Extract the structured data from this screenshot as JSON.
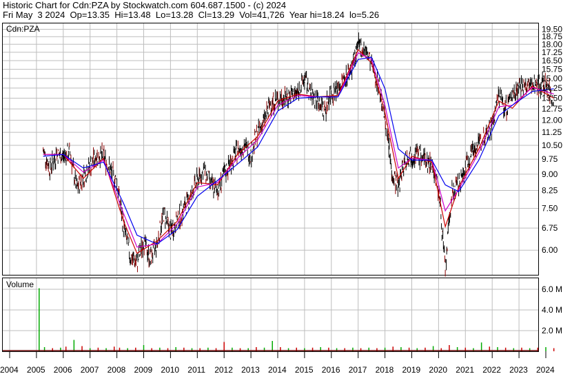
{
  "header": {
    "line1": "Historic Chart for Cdn:PZA by Stockwatch.com 604.687.1500 - (c) 2024",
    "line2": "Fri May  3 2024  Op=13.35  Hi=13.48  Lo=13.28  Cl=13.29  Vol=41,726  Year hi=18.24  lo=5.26"
  },
  "colors": {
    "price_bars": "#000000",
    "ma_short": "#cc0000",
    "ma_mid": "#cc00cc",
    "ma_long": "#0000ee",
    "vol_up": "#00aa00",
    "vol_down": "#cc0000",
    "grid": "#bdbdbd"
  },
  "chart_data": [
    {
      "type": "line",
      "label": "Cdn:PZA",
      "price_scale": "log",
      "ylim": [
        5.26,
        19.9
      ],
      "x_ticks": [
        "2004",
        "2005",
        "2006",
        "2007",
        "2008",
        "2009",
        "2010",
        "2011",
        "2012",
        "2013",
        "2014",
        "2015",
        "2016",
        "2017",
        "2018",
        "2019",
        "2020",
        "2021",
        "2022",
        "2023",
        "2024"
      ],
      "y_ticks": [
        "19.50",
        "18.75",
        "18.00",
        "17.25",
        "16.50",
        "15.75",
        "15.00",
        "14.25",
        "13.50",
        "12.75",
        "12.00",
        "11.25",
        "10.50",
        "9.75",
        "9.00",
        "8.25",
        "7.50",
        "6.75",
        "6.00"
      ],
      "grid": true,
      "series": [
        {
          "key": "price",
          "x": [
            2005.25,
            2005.5,
            2005.75,
            2006.0,
            2006.25,
            2006.5,
            2006.75,
            2007.0,
            2007.25,
            2007.5,
            2007.75,
            2008.0,
            2008.25,
            2008.5,
            2008.75,
            2009.0,
            2009.25,
            2009.5,
            2009.75,
            2010.0,
            2010.25,
            2010.5,
            2010.75,
            2011.0,
            2011.25,
            2011.5,
            2011.75,
            2012.0,
            2012.25,
            2012.5,
            2012.75,
            2013.0,
            2013.25,
            2013.5,
            2013.75,
            2014.0,
            2014.25,
            2014.5,
            2014.75,
            2015.0,
            2015.25,
            2015.5,
            2015.75,
            2016.0,
            2016.25,
            2016.5,
            2016.75,
            2017.0,
            2017.25,
            2017.5,
            2017.75,
            2018.0,
            2018.25,
            2018.5,
            2018.75,
            2019.0,
            2019.25,
            2019.5,
            2019.75,
            2020.0,
            2020.25,
            2020.5,
            2020.75,
            2021.0,
            2021.25,
            2021.5,
            2021.75,
            2022.0,
            2022.25,
            2022.5,
            2022.75,
            2023.0,
            2023.25,
            2023.5,
            2023.75,
            2024.0,
            2024.3
          ],
          "y": [
            10.2,
            9.3,
            10.0,
            9.9,
            10.1,
            8.3,
            8.9,
            9.4,
            10.0,
            9.9,
            9.2,
            8.6,
            6.8,
            5.8,
            5.6,
            6.3,
            5.7,
            6.2,
            7.3,
            6.6,
            7.0,
            7.5,
            8.0,
            8.7,
            9.2,
            8.5,
            8.3,
            9.0,
            9.6,
            10.2,
            10.5,
            10.0,
            11.2,
            12.0,
            13.2,
            13.4,
            13.6,
            13.7,
            13.9,
            15.0,
            13.7,
            13.4,
            12.6,
            14.0,
            14.1,
            15.0,
            15.9,
            17.8,
            17.5,
            16.2,
            14.6,
            12.2,
            9.1,
            8.4,
            9.8,
            10.0,
            10.0,
            9.7,
            9.5,
            8.3,
            5.3,
            8.2,
            8.5,
            9.3,
            10.3,
            10.5,
            11.2,
            11.6,
            13.8,
            12.7,
            13.8,
            14.5,
            14.2,
            14.6,
            14.5,
            14.5,
            13.29
          ]
        },
        {
          "key": "ma_short",
          "x": [
            2005.25,
            2006.0,
            2006.75,
            2007.5,
            2008.25,
            2008.75,
            2009.5,
            2010.25,
            2011.0,
            2011.75,
            2012.5,
            2013.25,
            2014.0,
            2014.75,
            2015.5,
            2016.25,
            2017.0,
            2017.5,
            2018.0,
            2018.5,
            2019.0,
            2019.75,
            2020.25,
            2020.75,
            2021.5,
            2022.25,
            2022.75,
            2023.5,
            2024.3
          ],
          "y": [
            10.0,
            10.0,
            8.8,
            9.8,
            7.0,
            5.9,
            6.3,
            7.0,
            8.6,
            8.5,
            10.0,
            11.0,
            13.3,
            13.8,
            13.6,
            13.7,
            17.5,
            16.3,
            12.5,
            8.8,
            9.9,
            9.6,
            6.8,
            8.4,
            10.3,
            13.3,
            12.8,
            14.4,
            13.5
          ]
        },
        {
          "key": "ma_mid",
          "x": [
            2005.25,
            2006.0,
            2006.75,
            2007.5,
            2008.25,
            2008.75,
            2009.5,
            2010.25,
            2011.0,
            2011.75,
            2012.5,
            2013.25,
            2014.0,
            2014.75,
            2015.5,
            2016.25,
            2017.0,
            2017.5,
            2018.0,
            2018.5,
            2019.0,
            2019.75,
            2020.25,
            2020.75,
            2021.5,
            2022.25,
            2022.75,
            2023.5,
            2024.3
          ],
          "y": [
            10.0,
            10.0,
            9.1,
            9.7,
            7.3,
            6.1,
            6.2,
            6.9,
            8.4,
            8.6,
            9.8,
            10.8,
            13.0,
            13.7,
            13.6,
            13.6,
            17.2,
            16.6,
            13.0,
            9.3,
            9.8,
            9.7,
            7.4,
            8.3,
            10.1,
            12.9,
            13.0,
            14.3,
            13.8
          ]
        },
        {
          "key": "ma_long",
          "x": [
            2005.25,
            2006.0,
            2006.75,
            2007.5,
            2008.25,
            2008.75,
            2009.5,
            2010.25,
            2011.0,
            2011.75,
            2012.5,
            2013.25,
            2014.0,
            2014.75,
            2015.5,
            2016.25,
            2017.0,
            2017.5,
            2018.0,
            2018.5,
            2019.0,
            2019.75,
            2020.25,
            2020.75,
            2021.5,
            2022.25,
            2022.75,
            2023.5,
            2024.3
          ],
          "y": [
            9.9,
            10.0,
            9.3,
            9.6,
            7.7,
            6.5,
            6.2,
            6.7,
            8.0,
            8.7,
            9.5,
            10.4,
            12.6,
            13.5,
            13.6,
            13.6,
            16.6,
            16.8,
            14.2,
            10.3,
            9.7,
            9.7,
            8.5,
            8.2,
            9.7,
            12.3,
            13.0,
            14.0,
            14.2
          ]
        }
      ]
    },
    {
      "type": "bar",
      "title": "Volume",
      "ylim": [
        0,
        6800000
      ],
      "y_ticks": [
        "6.0 M",
        "4.0 M",
        "2.0 M"
      ],
      "x": [
        2005.1,
        2005.3,
        2005.6,
        2005.9,
        2006.1,
        2006.4,
        2006.7,
        2007.0,
        2007.3,
        2007.6,
        2007.9,
        2008.1,
        2008.4,
        2008.7,
        2009.0,
        2009.3,
        2009.6,
        2009.9,
        2010.2,
        2010.5,
        2010.8,
        2011.1,
        2011.4,
        2011.7,
        2012.0,
        2012.3,
        2012.6,
        2012.9,
        2013.2,
        2013.5,
        2013.8,
        2014.1,
        2014.4,
        2014.7,
        2015.0,
        2015.3,
        2015.6,
        2015.9,
        2016.2,
        2016.5,
        2016.8,
        2017.1,
        2017.4,
        2017.7,
        2018.0,
        2018.3,
        2018.6,
        2018.9,
        2019.2,
        2019.5,
        2019.8,
        2020.1,
        2020.4,
        2020.7,
        2021.0,
        2021.3,
        2021.6,
        2021.9,
        2022.2,
        2022.5,
        2022.8,
        2023.1,
        2023.4,
        2023.7,
        2024.0,
        2024.3
      ],
      "values": [
        6100000,
        400000,
        300000,
        350000,
        450000,
        1100000,
        500000,
        300000,
        350000,
        300000,
        450000,
        350000,
        300000,
        350000,
        600000,
        300000,
        350000,
        300000,
        400000,
        350000,
        300000,
        300000,
        350000,
        300000,
        900000,
        350000,
        300000,
        300000,
        400000,
        350000,
        1000000,
        400000,
        300000,
        350000,
        300000,
        350000,
        400000,
        350000,
        300000,
        300000,
        350000,
        300000,
        350000,
        300000,
        350000,
        450000,
        400000,
        350000,
        300000,
        350000,
        500000,
        300000,
        600000,
        400000,
        350000,
        300000,
        850000,
        450000,
        400000,
        350000,
        300000,
        350000,
        300000,
        350000,
        400000,
        300000
      ],
      "up": [
        true,
        true,
        false,
        true,
        false,
        true,
        false,
        true,
        false,
        true,
        false,
        false,
        true,
        false,
        true,
        false,
        true,
        false,
        true,
        false,
        true,
        false,
        true,
        false,
        false,
        true,
        false,
        true,
        false,
        true,
        true,
        false,
        true,
        false,
        true,
        false,
        true,
        false,
        true,
        false,
        true,
        false,
        true,
        false,
        true,
        false,
        true,
        false,
        true,
        false,
        true,
        false,
        false,
        true,
        false,
        true,
        true,
        false,
        true,
        false,
        true,
        false,
        true,
        false,
        true,
        false
      ]
    }
  ]
}
